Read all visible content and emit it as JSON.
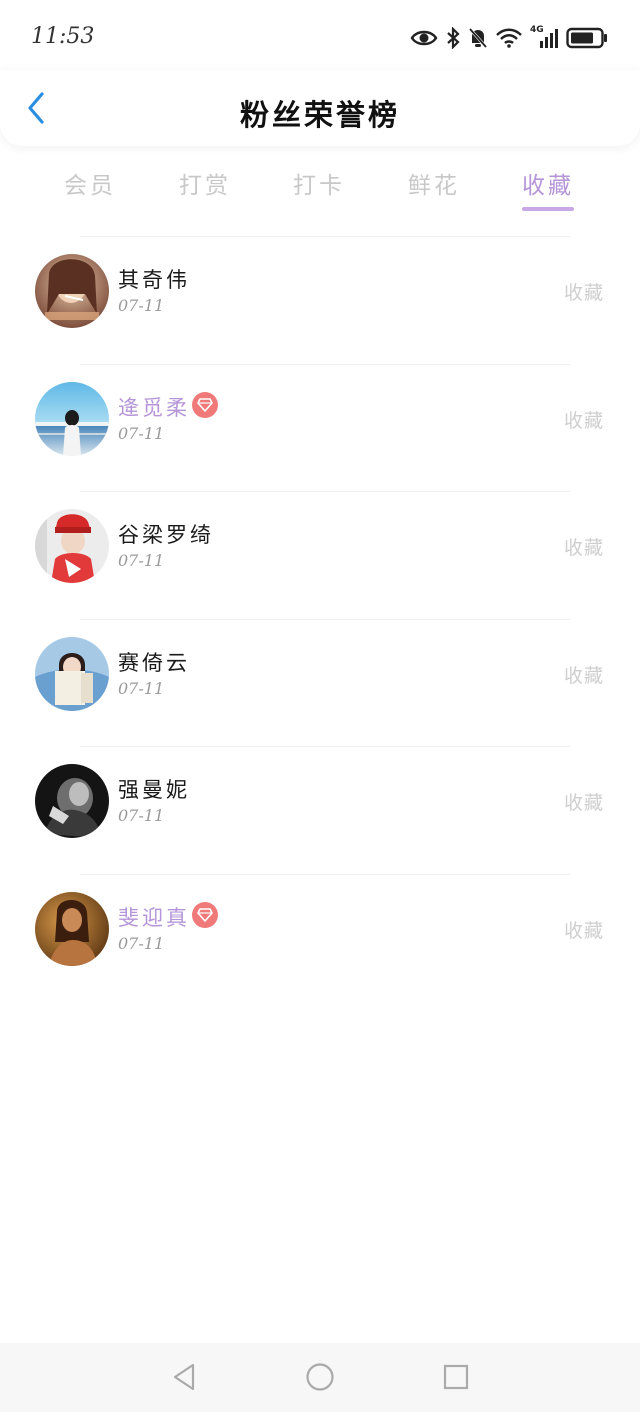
{
  "status_bar": {
    "time": "11:53",
    "icons": [
      "eye-icon",
      "bluetooth-icon",
      "bell-muted-icon",
      "wifi-icon",
      "signal-4g-icon",
      "battery-icon"
    ],
    "network_label": "4G"
  },
  "header": {
    "title": "粉丝荣誉榜",
    "back_icon": "chevron-left-icon",
    "accent_color": "#2a8fe0"
  },
  "tabs": [
    {
      "label": "会员",
      "active": false
    },
    {
      "label": "打赏",
      "active": false
    },
    {
      "label": "打卡",
      "active": false
    },
    {
      "label": "鲜花",
      "active": false
    },
    {
      "label": "收藏",
      "active": true
    }
  ],
  "colors": {
    "active_tab": "#b595d8",
    "inactive_tab": "#c8c8c8",
    "vip_name": "#b595d8",
    "vip_badge": "#f07a7a"
  },
  "fans": [
    {
      "name": "其奇伟",
      "date": "07-11",
      "action": "收藏",
      "vip": false,
      "avatar": "woman-smoking-photo"
    },
    {
      "name": "逄觅柔",
      "date": "07-11",
      "action": "收藏",
      "vip": true,
      "avatar": "girl-by-sea-photo"
    },
    {
      "name": "谷梁罗绮",
      "date": "07-11",
      "action": "收藏",
      "vip": false,
      "avatar": "man-red-hat-photo"
    },
    {
      "name": "赛倚云",
      "date": "07-11",
      "action": "收藏",
      "vip": false,
      "avatar": "girl-reading-photo"
    },
    {
      "name": "强曼妮",
      "date": "07-11",
      "action": "收藏",
      "vip": false,
      "avatar": "monochrome-portrait-photo"
    },
    {
      "name": "斐迎真",
      "date": "07-11",
      "action": "收藏",
      "vip": true,
      "avatar": "woman-portrait-photo"
    }
  ],
  "nav_bar": {
    "buttons": [
      "back-triangle-icon",
      "home-circle-icon",
      "recents-square-icon"
    ]
  }
}
